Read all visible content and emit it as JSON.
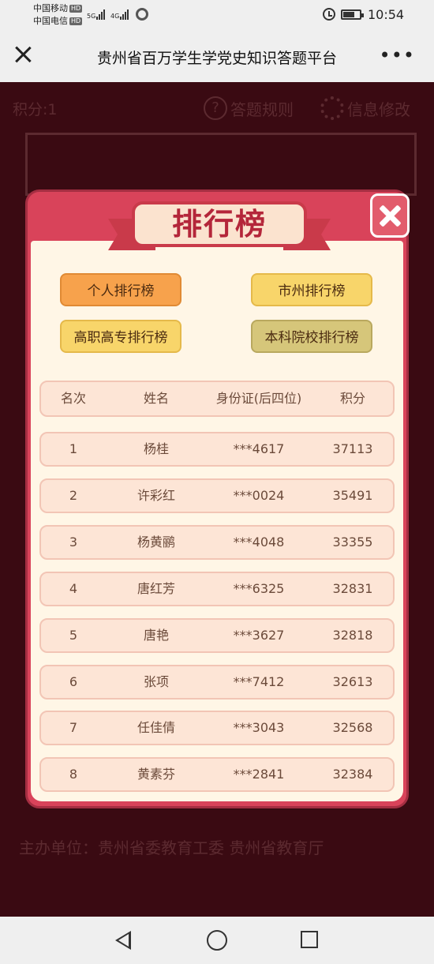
{
  "status_bar": {
    "carrier1": "中国移动",
    "carrier2": "中国电信",
    "hd_badge": "HD",
    "network1": "5G",
    "network2": "4G",
    "time": "10:54"
  },
  "title_bar": {
    "title": "贵州省百万学生学党史知识答题平台",
    "more_label": "•••"
  },
  "page": {
    "score_label": "积分:1",
    "rules_label": "答题规则",
    "info_label": "信息修改",
    "organizer": "主办单位：贵州省委教育工委  贵州省教育厅"
  },
  "modal": {
    "title": "排行榜",
    "tabs": [
      {
        "label": "个人排行榜",
        "state": "active"
      },
      {
        "label": "市州排行榜",
        "state": "inactive"
      },
      {
        "label": "高职高专排行榜",
        "state": "inactive"
      },
      {
        "label": "本科院校排行榜",
        "state": "inactive"
      }
    ],
    "columns": [
      "名次",
      "姓名",
      "身份证(后四位)",
      "积分"
    ],
    "rows": [
      {
        "rank": "1",
        "name": "杨桂",
        "id": "***4617",
        "score": "37113"
      },
      {
        "rank": "2",
        "name": "许彩红",
        "id": "***0024",
        "score": "35491"
      },
      {
        "rank": "3",
        "name": "杨黄鹂",
        "id": "***4048",
        "score": "33355"
      },
      {
        "rank": "4",
        "name": "唐红芳",
        "id": "***6325",
        "score": "32831"
      },
      {
        "rank": "5",
        "name": "唐艳",
        "id": "***3627",
        "score": "32818"
      },
      {
        "rank": "6",
        "name": "张项",
        "id": "***7412",
        "score": "32613"
      },
      {
        "rank": "7",
        "name": "任佳倩",
        "id": "***3043",
        "score": "32568"
      },
      {
        "rank": "8",
        "name": "黄素芬",
        "id": "***2841",
        "score": "32384"
      }
    ]
  },
  "colors": {
    "page_bg": "#3a0a12",
    "modal_red": "#d9435a",
    "panel_cream": "#fff6e6",
    "row_pink": "#fde5d6",
    "tab_active": "#f7a24c",
    "tab_yellow": "#f8d56a"
  }
}
